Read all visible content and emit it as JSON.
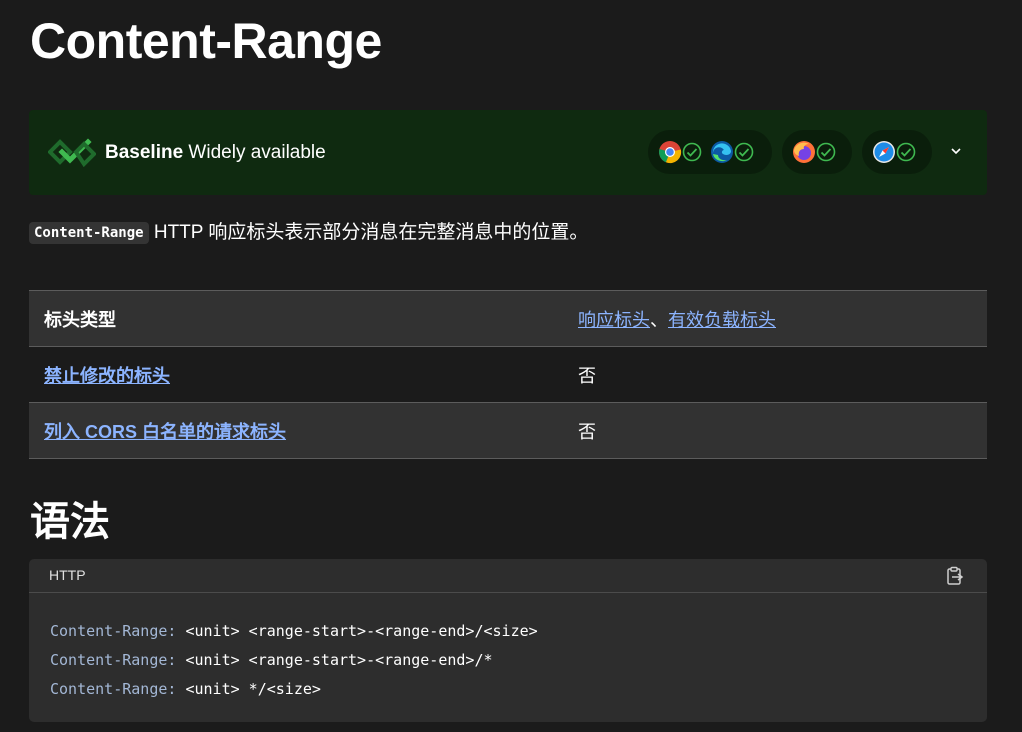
{
  "page_title": "Content-Range",
  "baseline": {
    "label_bold": "Baseline",
    "label_rest": " Widely available",
    "browsers": [
      {
        "name": "chrome-icon",
        "supported": true
      },
      {
        "name": "edge-icon",
        "supported": true
      },
      {
        "name": "firefox-icon",
        "supported": true
      },
      {
        "name": "safari-icon",
        "supported": true
      }
    ]
  },
  "intro": {
    "code": "Content-Range",
    "text": " HTTP 响应标头表示部分消息在完整消息中的位置。"
  },
  "properties": {
    "rows": [
      {
        "key": "标头类型",
        "key_link": false,
        "value_links": [
          "响应标头",
          "有效负载标头"
        ],
        "value_sep": "、"
      },
      {
        "key": "禁止修改的标头",
        "key_link": true,
        "value": "否"
      },
      {
        "key": "列入 CORS 白名单的请求标头",
        "key_link": true,
        "value": "否"
      }
    ]
  },
  "syntax": {
    "heading": "语法",
    "lang": "HTTP",
    "lines": [
      {
        "name": "Content-Range:",
        "rest": " <unit> <range-start>-<range-end>/<size>"
      },
      {
        "name": "Content-Range:",
        "rest": " <unit> <range-start>-<range-end>/*"
      },
      {
        "name": "Content-Range:",
        "rest": " <unit> */<size>"
      }
    ]
  },
  "colors": {
    "background": "#1b1b1b",
    "baseline_bg": "#0f2a10",
    "link": "#8cb4ff",
    "check": "#3fb950"
  }
}
